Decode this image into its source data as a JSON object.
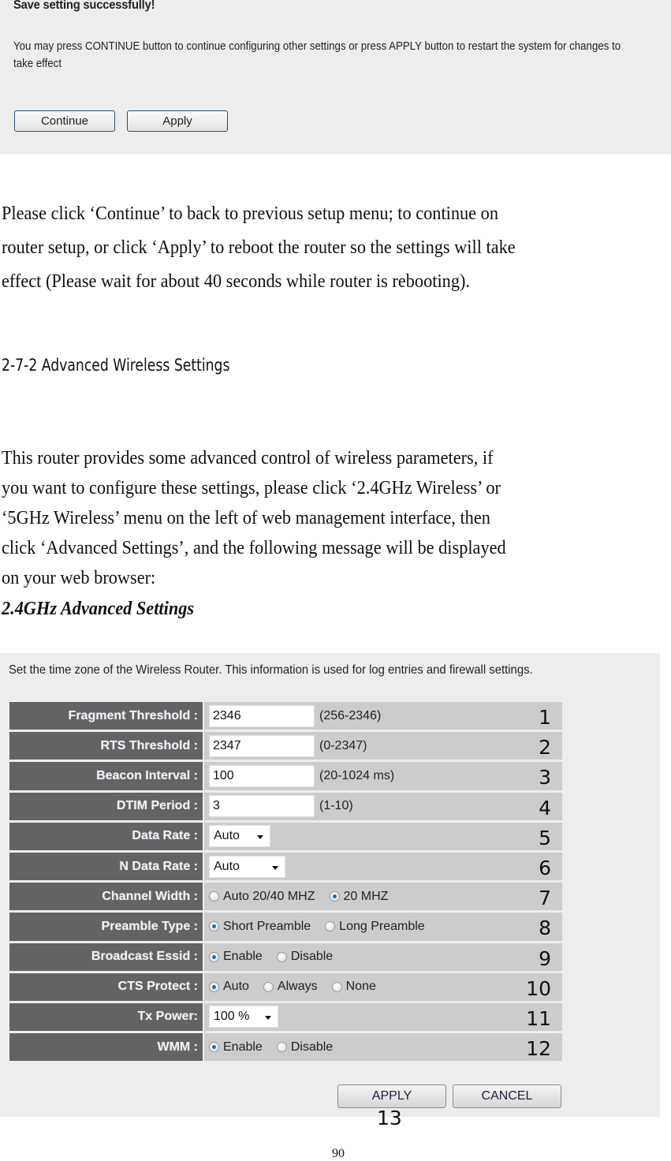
{
  "save_dialog": {
    "title": "Save setting successfully!",
    "message": "You may press CONTINUE button to continue configuring other settings or press APPLY button to restart the system for changes to take effect",
    "continue_label": "Continue",
    "apply_label": "Apply"
  },
  "document": {
    "paragraph1": [
      "Please click ‘Continue’ to back to previous setup menu; to continue on",
      "router setup, or click ‘Apply’ to reboot the router so the settings will take",
      "effect (Please wait for about 40 seconds while router is rebooting)."
    ],
    "section_heading": "2-7-2 Advanced Wireless Settings",
    "paragraph2": [
      "This router provides some advanced control of wireless parameters, if",
      "you want to configure these settings, please click ‘2.4GHz Wireless’ or",
      "‘5GHz Wireless’ menu on the left of web management interface, then",
      "click ‘Advanced Settings’, and the following message will be displayed",
      "on your web browser:"
    ],
    "subsection_title": "2.4GHz Advanced Settings",
    "page_number": "90"
  },
  "advanced_settings": {
    "description": "Set the time zone of the Wireless Router. This information is used for log entries and firewall settings.",
    "rows": [
      {
        "label": "Fragment Threshold :",
        "type": "text",
        "value": "2346",
        "hint": "(256-2346)",
        "callout": "1"
      },
      {
        "label": "RTS Threshold :",
        "type": "text",
        "value": "2347",
        "hint": "(0-2347)",
        "callout": "2"
      },
      {
        "label": "Beacon Interval :",
        "type": "text",
        "value": "100",
        "hint": "(20-1024 ms)",
        "callout": "3"
      },
      {
        "label": "DTIM Period :",
        "type": "text",
        "value": "3",
        "hint": "(1-10)",
        "callout": "4"
      },
      {
        "label": "Data Rate :",
        "type": "select",
        "value": "Auto",
        "callout": "5"
      },
      {
        "label": "N Data Rate :",
        "type": "select",
        "value": "Auto",
        "callout": "6"
      },
      {
        "label": "Channel Width :",
        "type": "radio",
        "options": [
          "Auto 20/40 MHZ",
          "20 MHZ"
        ],
        "selected": "20 MHZ",
        "callout": "7"
      },
      {
        "label": "Preamble Type :",
        "type": "radio",
        "options": [
          "Short Preamble",
          "Long Preamble"
        ],
        "selected": "Short Preamble",
        "callout": "8"
      },
      {
        "label": "Broadcast Essid :",
        "type": "radio",
        "options": [
          "Enable",
          "Disable"
        ],
        "selected": "Enable",
        "callout": "9"
      },
      {
        "label": "CTS Protect :",
        "type": "radio",
        "options": [
          "Auto",
          "Always",
          "None"
        ],
        "selected": "Auto",
        "callout": "10"
      },
      {
        "label": "Tx Power:",
        "type": "select",
        "value": "100 %",
        "callout": "11"
      },
      {
        "label": "WMM :",
        "type": "radio",
        "options": [
          "Enable",
          "Disable"
        ],
        "selected": "Enable",
        "callout": "12"
      }
    ],
    "apply_label": "APPLY",
    "cancel_label": "CANCEL",
    "buttons_callout": "13"
  }
}
